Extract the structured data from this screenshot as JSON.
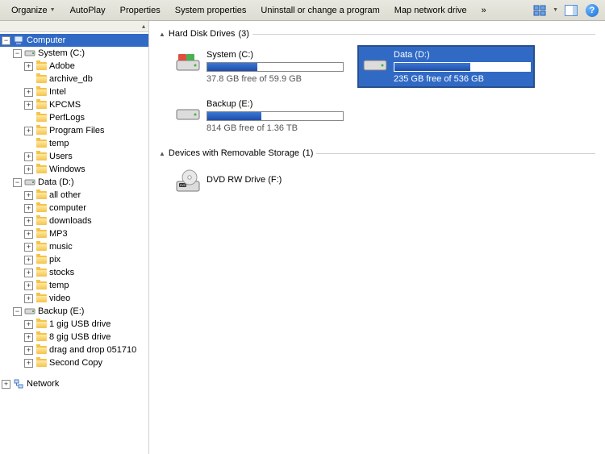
{
  "toolbar": {
    "organize": "Organize",
    "autoplay": "AutoPlay",
    "properties": "Properties",
    "system_properties": "System properties",
    "uninstall": "Uninstall or change a program",
    "map_drive": "Map network drive",
    "overflow": "»"
  },
  "tree": {
    "computer": "Computer",
    "system_c": "System (C:)",
    "system_c_children": [
      "Adobe",
      "archive_db",
      "Intel",
      "KPCMS",
      "PerfLogs",
      "Program Files",
      "temp",
      "Users",
      "Windows"
    ],
    "data_d": "Data (D:)",
    "data_d_children": [
      "all other",
      "computer",
      "downloads",
      "MP3",
      "music",
      "pix",
      "stocks",
      "temp",
      "video"
    ],
    "backup_e": "Backup (E:)",
    "backup_e_children": [
      "1 gig USB drive",
      "8 gig USB drive",
      "drag and drop 051710",
      "Second Copy"
    ],
    "network": "Network"
  },
  "groups": {
    "hdd": {
      "label": "Hard Disk Drives",
      "count": "(3)"
    },
    "removable": {
      "label": "Devices with Removable Storage",
      "count": "(1)"
    }
  },
  "drives": {
    "system": {
      "name": "System (C:)",
      "free": "37.8 GB free of 59.9 GB",
      "fill_pct": 37
    },
    "data": {
      "name": "Data (D:)",
      "free": "235 GB free of 536 GB",
      "fill_pct": 56
    },
    "backup": {
      "name": "Backup (E:)",
      "free": "814 GB free of 1.36 TB",
      "fill_pct": 40
    },
    "dvd": {
      "name": "DVD RW Drive (F:)"
    }
  }
}
